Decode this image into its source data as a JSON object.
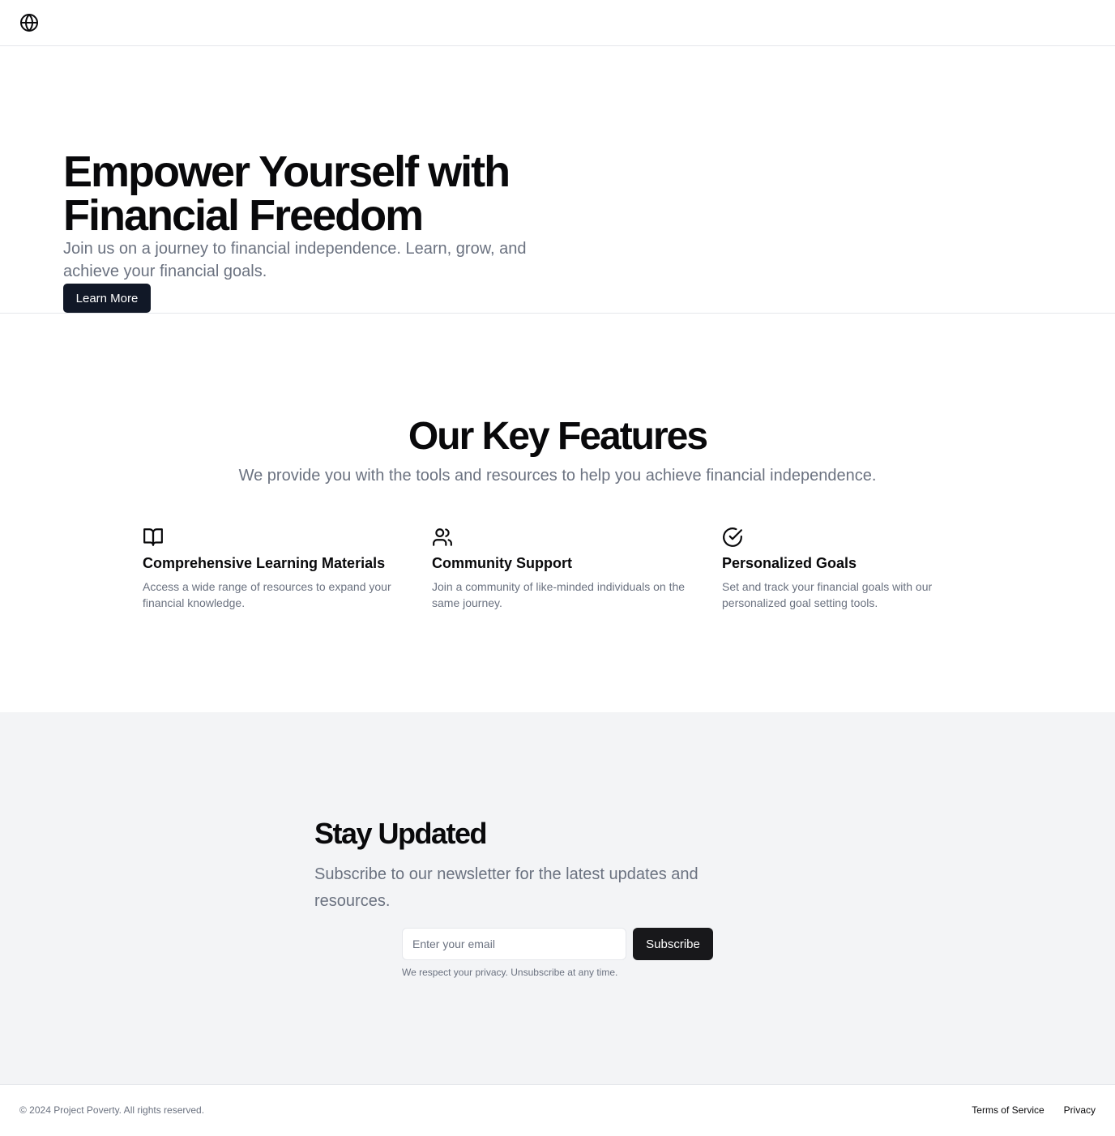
{
  "header": {
    "logo_icon": "globe-icon"
  },
  "hero": {
    "title": "Empower Yourself with Financial Freedom",
    "subtitle": "Join us on a journey to financial independence. Learn, grow, and achieve your financial goals.",
    "cta_label": "Learn More"
  },
  "features": {
    "title": "Our Key Features",
    "subtitle": "We provide you with the tools and resources to help you achieve financial independence.",
    "items": [
      {
        "icon": "book-open-icon",
        "title": "Comprehensive Learning Materials",
        "description": "Access a wide range of resources to expand your financial knowledge."
      },
      {
        "icon": "users-icon",
        "title": "Community Support",
        "description": "Join a community of like-minded individuals on the same journey."
      },
      {
        "icon": "check-circle-icon",
        "title": "Personalized Goals",
        "description": "Set and track your financial goals with our personalized goal setting tools."
      }
    ]
  },
  "newsletter": {
    "title": "Stay Updated",
    "subtitle": "Subscribe to our newsletter for the latest updates and resources.",
    "email_placeholder": "Enter your email",
    "email_value": "",
    "subscribe_label": "Subscribe",
    "privacy_note": "We respect your privacy. Unsubscribe at any time."
  },
  "footer": {
    "copyright": "© 2024 Project Poverty. All rights reserved.",
    "links": [
      "Terms of Service",
      "Privacy"
    ]
  },
  "colors": {
    "primary_button": "#111827",
    "subscribe_button": "#18181b",
    "muted_text": "#6b7280",
    "newsletter_bg": "#f3f4f6",
    "border": "#e5e7eb"
  }
}
